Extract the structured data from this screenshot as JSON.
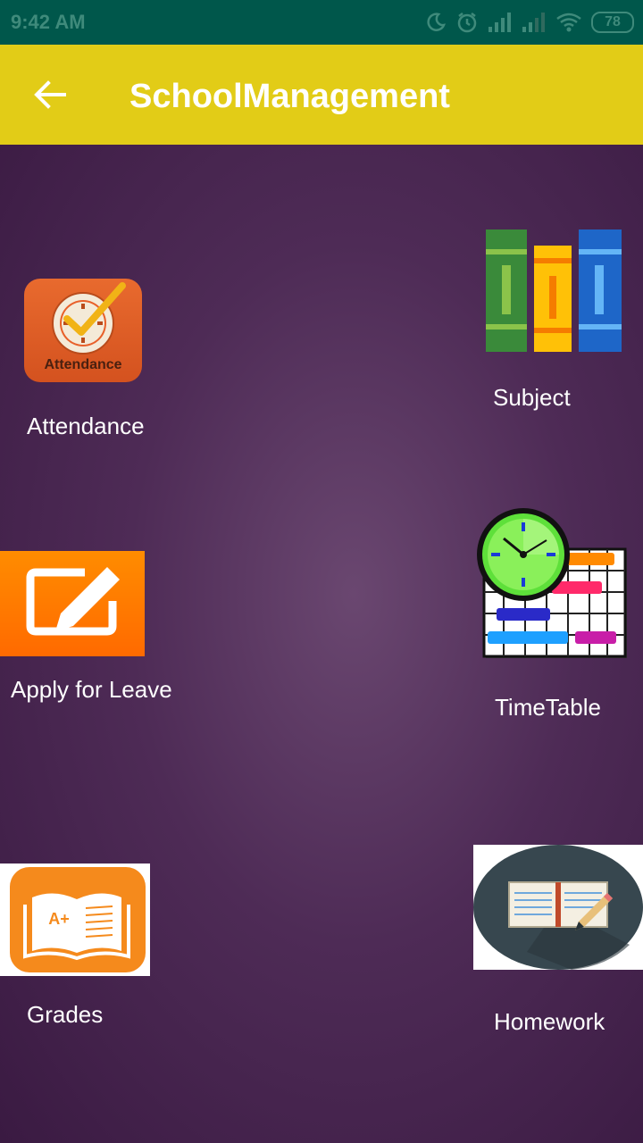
{
  "status_bar": {
    "time": "9:42 AM",
    "battery": "78",
    "icons": [
      "moon-icon",
      "alarm-icon",
      "signal-icon",
      "signal-icon",
      "wifi-icon",
      "battery-icon"
    ]
  },
  "app_bar": {
    "title": "SchoolManagement",
    "back_icon": "arrow-left-icon",
    "color": "#e2cc17"
  },
  "tiles": {
    "attendance": {
      "label": "Attendance",
      "icon_text": "Attendance"
    },
    "subject": {
      "label": "Subject"
    },
    "apply_leave": {
      "label": "Apply for Leave"
    },
    "timetable": {
      "label": "TimeTable"
    },
    "grades": {
      "label": "Grades",
      "icon_text": "A+"
    },
    "homework": {
      "label": "Homework"
    }
  },
  "colors": {
    "status_bar": "#00574b",
    "background": "#4e2b56",
    "accent_orange": "#f07a10"
  }
}
